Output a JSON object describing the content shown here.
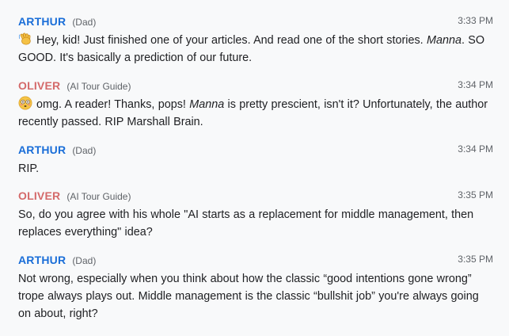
{
  "colors": {
    "arthur": "#1a6ed8",
    "oliver": "#d46a6a"
  },
  "messages": [
    {
      "name": "ARTHUR",
      "role": "(Dad)",
      "time": "3:33 PM",
      "emoji": "waving-hand-icon",
      "text_a": "Hey, kid! Just finished one of your articles. And read one of the short stories. ",
      "em": "Manna",
      "text_b": ". SO GOOD. It's basically a prediction of our future."
    },
    {
      "name": "OLIVER",
      "role": "(AI Tour Guide)",
      "time": "3:34 PM",
      "emoji": "flushed-face-icon",
      "text_a": "omg. A reader! Thanks, pops! ",
      "em": "Manna",
      "text_b": " is pretty prescient, isn't it? Unfortunately, the author recently passed. RIP Marshall Brain."
    },
    {
      "name": "ARTHUR",
      "role": "(Dad)",
      "time": "3:34 PM",
      "text": "RIP."
    },
    {
      "name": "OLIVER",
      "role": "(AI Tour Guide)",
      "time": "3:35 PM",
      "text": "So, do you agree with his whole \"AI starts as a replacement for middle management, then replaces everything\" idea?"
    },
    {
      "name": "ARTHUR",
      "role": "(Dad)",
      "time": "3:35 PM",
      "text": "Not wrong, especially when you think about how the classic “good intentions gone wrong” trope always plays out. Middle management is the classic “bullshit job” you're always going on about, right?"
    }
  ]
}
